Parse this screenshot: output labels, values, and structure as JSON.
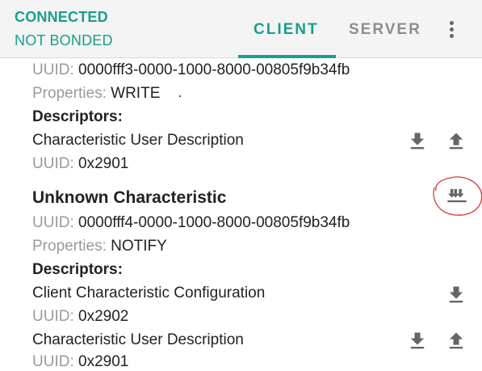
{
  "header": {
    "connection_status": "CONNECTED",
    "bond_status": "NOT BONDED",
    "tabs": [
      {
        "label": "CLIENT",
        "active": true
      },
      {
        "label": "SERVER",
        "active": false
      }
    ],
    "overflow_icon": "more-vert-icon",
    "accent_color": "#1a9e8b"
  },
  "content": {
    "char1": {
      "uuid_label": "UUID:",
      "uuid": "0000fff3-0000-1000-8000-00805f9b34fb",
      "properties_label": "Properties:",
      "properties": "WRITE",
      "descriptors_heading": "Descriptors:",
      "descriptor": {
        "name": "Characteristic User Description",
        "uuid_label": "UUID:",
        "uuid": "0x2901"
      }
    },
    "char2": {
      "title": "Unknown Characteristic",
      "uuid_label": "UUID:",
      "uuid": "0000fff4-0000-1000-8000-00805f9b34fb",
      "properties_label": "Properties:",
      "properties": "NOTIFY",
      "descriptors_heading": "Descriptors:",
      "descriptors": [
        {
          "name": "Client Characteristic Configuration",
          "uuid_label": "UUID:",
          "uuid": "0x2902"
        },
        {
          "name": "Characteristic User Description",
          "uuid_label": "UUID:",
          "uuid": "0x2901"
        }
      ]
    }
  },
  "icons": {
    "read": "download-icon",
    "write": "upload-icon",
    "notify": "notify-multiple-download-icon"
  }
}
